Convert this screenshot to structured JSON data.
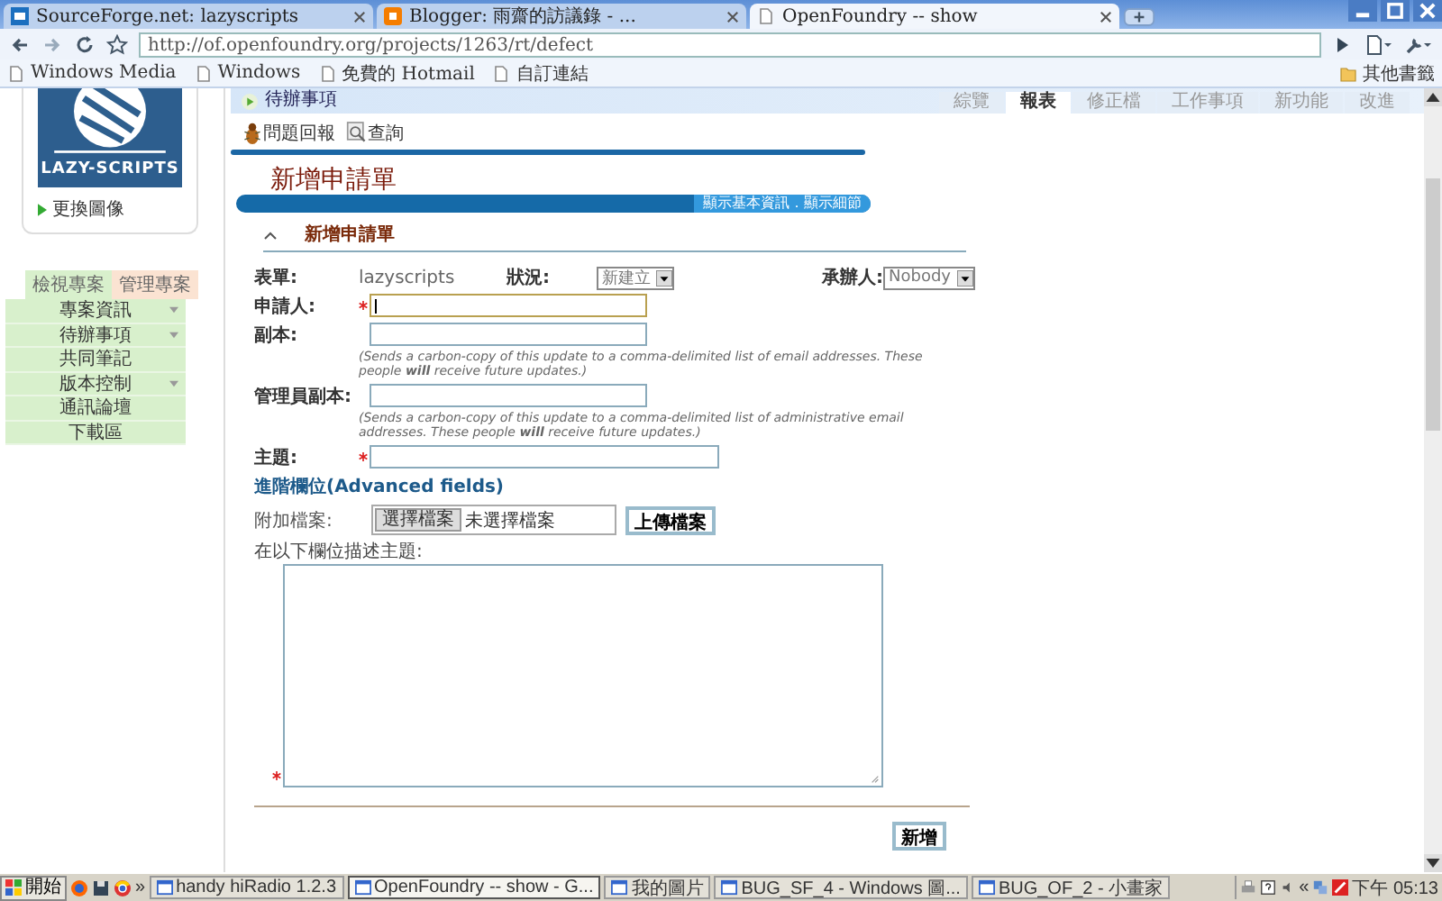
{
  "browser": {
    "tabs": [
      {
        "title": "SourceForge.net: lazyscripts",
        "kind": "sf",
        "selected": false
      },
      {
        "title": "Blogger: 雨齋的訪議錄 - ...",
        "kind": "blogger",
        "selected": false
      },
      {
        "title": "OpenFoundry -- show",
        "kind": "page",
        "selected": true
      }
    ],
    "url": "http://of.openfoundry.org/projects/1263/rt/defect",
    "bookmarks": [
      "Windows Media",
      "Windows",
      "免費的 Hotmail",
      "自訂連結"
    ],
    "other_bookmarks": "其他書籤"
  },
  "sidebar": {
    "logo_text": "LAZY-SCRIPTS",
    "change_image": "更換圖像",
    "tabs": [
      {
        "label": "檢視專案",
        "selected": true
      },
      {
        "label": "管理專案",
        "selected": false
      }
    ],
    "menu": [
      {
        "label": "專案資訊",
        "expandable": true
      },
      {
        "label": "待辦事項",
        "expandable": true
      },
      {
        "label": "共同筆記",
        "expandable": false
      },
      {
        "label": "版本控制",
        "expandable": true
      },
      {
        "label": "通訊論壇",
        "expandable": false
      },
      {
        "label": "下載區",
        "expandable": false
      }
    ]
  },
  "header": {
    "title": "待辦事項",
    "nav": [
      {
        "label": "綜覽",
        "selected": false
      },
      {
        "label": "報表",
        "selected": true
      },
      {
        "label": "修正檔",
        "selected": false
      },
      {
        "label": "工作事項",
        "selected": false
      },
      {
        "label": "新功能",
        "selected": false
      },
      {
        "label": "改進",
        "selected": false
      }
    ]
  },
  "toolbar": [
    {
      "kind": "bug",
      "label": "問題回報"
    },
    {
      "kind": "search",
      "label": "查詢"
    }
  ],
  "form": {
    "title": "新增申請單",
    "bar_links": "顯示基本資訊．顯示細節",
    "section": "新增申請單",
    "meta": [
      {
        "label": "表單:",
        "value": "lazyscripts",
        "kind": "text"
      },
      {
        "label": "狀況:",
        "value": "新建立",
        "kind": "select"
      },
      {
        "label": "承辦人:",
        "value": "Nobody",
        "kind": "select"
      }
    ],
    "fields": [
      {
        "label": "申請人:",
        "required": true,
        "focused": true,
        "kind": "short"
      },
      {
        "label": "副本:",
        "required": false,
        "focused": false,
        "kind": "short",
        "help": "(Sends a carbon-copy of this update to a comma-delimited list of email addresses. These people **will** receive future updates.)"
      },
      {
        "label": "管理員副本:",
        "required": false,
        "focused": false,
        "kind": "short",
        "help": "(Sends a carbon-copy of this update to a comma-delimited list of administrative email addresses. These people **will** receive future updates.)"
      },
      {
        "label": "主題:",
        "required": true,
        "focused": false,
        "kind": "long"
      }
    ],
    "advanced": "進階欄位(Advanced fields)",
    "attach_label": "附加檔案:",
    "choose_file": "選擇檔案",
    "no_file": "未選擇檔案",
    "upload": "上傳檔案",
    "description_label": "在以下欄位描述主題:",
    "description_required": true,
    "submit": "新增"
  },
  "taskbar": {
    "start": "開始",
    "more": "»",
    "tasks": [
      {
        "label": "handy hiRadio 1.2.3",
        "selected": false
      },
      {
        "label": "OpenFoundry -- show - G...",
        "selected": true
      },
      {
        "label": "我的圖片",
        "selected": false
      },
      {
        "label": "BUG_SF_4 - Windows 圖...",
        "selected": false
      },
      {
        "label": "BUG_OF_2 - 小畫家",
        "selected": false
      }
    ],
    "tray_expand": "«",
    "clock": "下午 05:13"
  }
}
